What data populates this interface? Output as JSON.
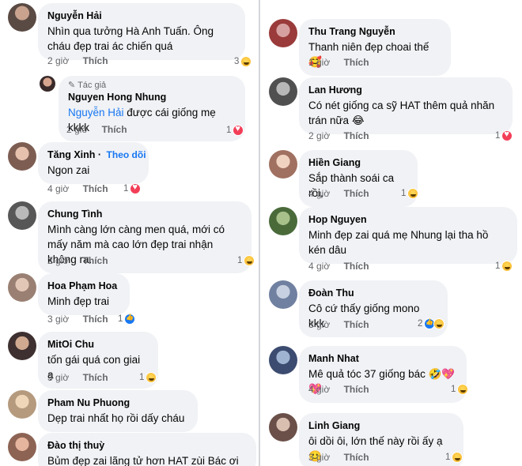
{
  "left_column": [
    {
      "name": "Nguyễn Hải",
      "text": "Nhìn qua tưởng Hà Anh Tuấn. Ông cháu đẹp trai ác chiến quá",
      "time": "2 giờ",
      "like": "Thích",
      "reaction_count": "3",
      "reactions": [
        "haha-icon"
      ]
    },
    {
      "author_tag": "Tác giả",
      "name": "Nguyen Hong Nhung",
      "mention": "Nguyễn Hải",
      "text": " được cái giống mẹ kkkk",
      "time": "2 giờ",
      "like": "Thích",
      "reaction_count": "1",
      "reactions": [
        "love-icon"
      ]
    },
    {
      "name": "Tăng Xinh",
      "follow": "Theo dõi",
      "text": "Ngon zai",
      "time": "4 giờ",
      "like": "Thích",
      "reaction_count": "1",
      "reactions": [
        "love-icon"
      ]
    },
    {
      "name": "Chung Tình",
      "text": "Mình càng lớn càng men quá, mới có mấy năm mà cao lớn đẹp trai nhận không ra.",
      "time": "2 giờ",
      "like": "Thích",
      "reaction_count": "1",
      "reactions": [
        "haha-icon"
      ]
    },
    {
      "name": "Hoa Phạm Hoa",
      "text": "Minh đẹp trai",
      "time": "3 giờ",
      "like": "Thích",
      "reaction_count": "1",
      "reactions": [
        "like-icon"
      ]
    },
    {
      "name": "MitOi Chu",
      "text": "tốn gái quá con giai ạ",
      "time": "3 giờ",
      "like": "Thích",
      "reaction_count": "1",
      "reactions": [
        "haha-icon"
      ]
    },
    {
      "name": "Pham Nu Phuong",
      "text": "Dẹp trai nhất họ rồi dấy cháu",
      "time": "",
      "like": "",
      "reaction_count": "",
      "reactions": []
    },
    {
      "name": "Đào thị thuỳ",
      "text": "Bủm đẹp zai lãng tử hơn HAT zùi Bác ơi",
      "time": "",
      "like": "",
      "reaction_count": "",
      "reactions": []
    }
  ],
  "right_column": [
    {
      "name": "Thu Trang Nguyễn",
      "text": "Thanh niên đẹp choai thế 🥰",
      "time": "1 giờ",
      "like": "Thích",
      "reaction_count": "",
      "reactions": []
    },
    {
      "name": "Lan Hương",
      "text": "Có nét giống ca sỹ HAT thêm quả nhăn trán nữa 😂",
      "time": "2 giờ",
      "like": "Thích",
      "reaction_count": "1",
      "reactions": [
        "love-icon"
      ]
    },
    {
      "name": "Hiền Giang",
      "text": "Sắp thành soái ca rồi,",
      "time": "4 giờ",
      "like": "Thích",
      "reaction_count": "1",
      "reactions": [
        "haha-icon"
      ]
    },
    {
      "name": "Hop Nguyen",
      "text": "Minh đẹp zai quá mẹ Nhung lại tha hồ kén dâu",
      "time": "4 giờ",
      "like": "Thích",
      "reaction_count": "1",
      "reactions": [
        "haha-icon"
      ]
    },
    {
      "name": "Đoàn Thu",
      "text": "Cô cứ thấy giống mono kkk",
      "time": "3 giờ",
      "like": "Thích",
      "reaction_count": "2",
      "reactions": [
        "like-icon",
        "haha-icon"
      ]
    },
    {
      "name": "Manh Nhat",
      "text": "Mê quả tóc 37 giống bác 🤣💖💖",
      "time": "4 giờ",
      "like": "Thích",
      "reaction_count": "1",
      "reactions": [
        "haha-icon"
      ]
    },
    {
      "name": "Linh Giang",
      "text": "ôi dồi ôi, lớn thế này rồi ấy ạ 🙂",
      "time": "3 giờ",
      "like": "Thích",
      "reaction_count": "1",
      "reactions": [
        "haha-icon"
      ]
    }
  ],
  "colors": {
    "bubble": "#f0f2f5",
    "link": "#1877f2",
    "meta": "#65676b",
    "divider": "#d3d6da"
  }
}
